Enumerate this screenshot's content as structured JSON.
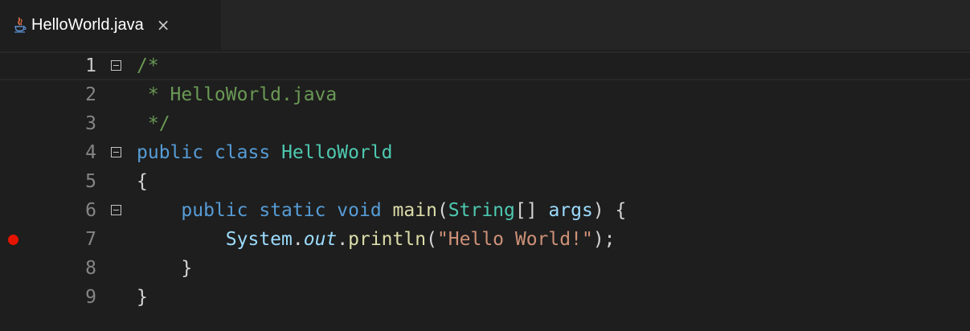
{
  "tab": {
    "label": "HelloWorld.java",
    "close_symbol": "×",
    "icon": "java-file-icon"
  },
  "editor": {
    "breakpoint_line": 7,
    "current_line": 1,
    "colors": {
      "background": "#1e1e1e",
      "comment": "#6a9955",
      "keyword": "#569cd6",
      "type": "#4ec9b0",
      "function": "#dcdcaa",
      "variable": "#9cdcfe",
      "string": "#ce9178",
      "breakpoint": "#e51400"
    },
    "lines": [
      {
        "num": "1",
        "foldable": true,
        "tokens": [
          {
            "t": "/*",
            "k": "comment"
          }
        ]
      },
      {
        "num": "2",
        "foldable": false,
        "tokens": [
          {
            "t": " * HelloWorld.java",
            "k": "comment"
          }
        ]
      },
      {
        "num": "3",
        "foldable": false,
        "tokens": [
          {
            "t": " */",
            "k": "comment"
          }
        ]
      },
      {
        "num": "4",
        "foldable": true,
        "tokens": [
          {
            "t": "public",
            "k": "kw"
          },
          {
            "t": " ",
            "k": "plain"
          },
          {
            "t": "class",
            "k": "kw"
          },
          {
            "t": " ",
            "k": "plain"
          },
          {
            "t": "HelloWorld",
            "k": "type"
          }
        ]
      },
      {
        "num": "5",
        "foldable": false,
        "tokens": [
          {
            "t": "{",
            "k": "plain"
          }
        ]
      },
      {
        "num": "6",
        "foldable": true,
        "tokens": [
          {
            "t": "    ",
            "k": "plain"
          },
          {
            "t": "public",
            "k": "kw"
          },
          {
            "t": " ",
            "k": "plain"
          },
          {
            "t": "static",
            "k": "kw"
          },
          {
            "t": " ",
            "k": "plain"
          },
          {
            "t": "void",
            "k": "kw"
          },
          {
            "t": " ",
            "k": "plain"
          },
          {
            "t": "main",
            "k": "fn"
          },
          {
            "t": "(",
            "k": "plain"
          },
          {
            "t": "String",
            "k": "type"
          },
          {
            "t": "[] ",
            "k": "plain"
          },
          {
            "t": "args",
            "k": "var"
          },
          {
            "t": ") {",
            "k": "plain"
          }
        ]
      },
      {
        "num": "7",
        "foldable": false,
        "tokens": [
          {
            "t": "        ",
            "k": "plain"
          },
          {
            "t": "System",
            "k": "var"
          },
          {
            "t": ".",
            "k": "plain"
          },
          {
            "t": "out",
            "k": "field"
          },
          {
            "t": ".",
            "k": "plain"
          },
          {
            "t": "println",
            "k": "fn"
          },
          {
            "t": "(",
            "k": "plain"
          },
          {
            "t": "\"Hello World!\"",
            "k": "str"
          },
          {
            "t": ");",
            "k": "plain"
          }
        ]
      },
      {
        "num": "8",
        "foldable": false,
        "tokens": [
          {
            "t": "    }",
            "k": "plain"
          }
        ]
      },
      {
        "num": "9",
        "foldable": false,
        "tokens": [
          {
            "t": "}",
            "k": "plain"
          }
        ]
      }
    ]
  }
}
